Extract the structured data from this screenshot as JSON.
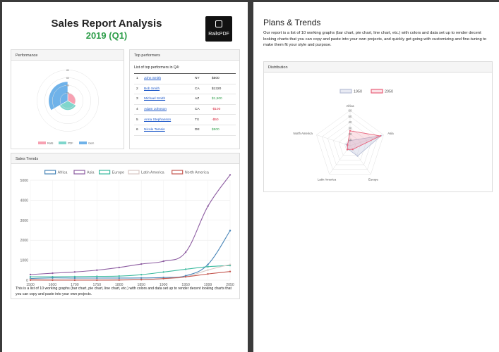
{
  "report": {
    "title": "Sales Report Analysis",
    "subtitle": "2019 (Q1)",
    "logo_text": "RailsPDF"
  },
  "performance": {
    "card_title": "Performance",
    "chart_data": {
      "type": "polar-area",
      "categories": [
        "Rails",
        "PDF",
        "Gem"
      ],
      "values": [
        20,
        25,
        50
      ],
      "colors": [
        "#f7a1b2",
        "#7fd6cc",
        "#6fb2e9"
      ],
      "ticks": [
        20,
        40,
        60,
        80
      ],
      "rmax": 90,
      "legend_position": "bottom"
    }
  },
  "top_performers": {
    "card_title": "Top performers",
    "caption": "List of top performers in Q4:",
    "rows": [
      {
        "num": "1",
        "name": "John Smith",
        "state": "NY",
        "amount": "$500",
        "tone": "neu"
      },
      {
        "num": "2",
        "name": "Bob Smith",
        "state": "CA",
        "amount": "$1320",
        "tone": "neu"
      },
      {
        "num": "3",
        "name": "Michael Smith",
        "state": "AZ",
        "amount": "$1,500",
        "tone": "pos"
      },
      {
        "num": "4",
        "name": "Adam Johnson",
        "state": "CA",
        "amount": "-$100",
        "tone": "neg"
      },
      {
        "num": "5",
        "name": "Anna Stephanson",
        "state": "TX",
        "amount": "-$50",
        "tone": "neg"
      },
      {
        "num": "6",
        "name": "Nicole Tamsin",
        "state": "DE",
        "amount": "$500",
        "tone": "pos"
      }
    ]
  },
  "sales_trends": {
    "card_title": "Sales Trends",
    "description": "This is a list of 10 working graphs (bar chart, pie chart, line chart, etc.) with colors and data set up to render decent looking charts that you can copy and paste into your own projects.",
    "chart_data": {
      "type": "line",
      "x": [
        1500,
        1600,
        1700,
        1750,
        1800,
        1850,
        1900,
        1950,
        1999,
        2050
      ],
      "series": [
        {
          "name": "Africa",
          "color": "#4a86b8",
          "values": [
            86,
            114,
            106,
            106,
            107,
            111,
            133,
            221,
            783,
            2478
          ]
        },
        {
          "name": "Asia",
          "color": "#8e5ea2",
          "values": [
            282,
            350,
            411,
            502,
            635,
            809,
            947,
            1402,
            3700,
            5267
          ]
        },
        {
          "name": "Europe",
          "color": "#3cba9f",
          "values": [
            168,
            170,
            178,
            190,
            203,
            276,
            408,
            547,
            675,
            734
          ]
        },
        {
          "name": "Latin America",
          "color": "#d8c9c5",
          "values": [
            40,
            20,
            10,
            16,
            24,
            38,
            74,
            167,
            508,
            784
          ]
        },
        {
          "name": "North America",
          "color": "#c45850",
          "values": [
            6,
            3,
            2,
            2,
            7,
            26,
            82,
            172,
            312,
            433
          ]
        }
      ],
      "ylim": [
        0,
        5000
      ],
      "yticks": [
        0,
        1000,
        2000,
        3000,
        4000,
        5000
      ],
      "grid": true,
      "legend_position": "top"
    }
  },
  "plans": {
    "title": "Plans & Trends",
    "text": "Our report is a list of 10 working graphs (bar chart, pie chart, line chart, etc.) with colors and data set up to render decent looking charts that you can copy and paste into your own projects, and quickly get going with customizing and fine-tuning to make them fit your style and purpose."
  },
  "distribution": {
    "card_title": "Distribution",
    "chart_data": {
      "type": "radar",
      "axes": [
        "Africa",
        "Asia",
        "Europe",
        "Latin America",
        "North America"
      ],
      "series": [
        {
          "name": "1950",
          "color": "#b8bfd6",
          "fill": "rgba(190,196,220,0.35)",
          "values": [
            8.77,
            55.61,
            21.69,
            6.62,
            6.82
          ]
        },
        {
          "name": "2050",
          "color": "#e8617a",
          "fill": "rgba(232,97,122,0.18)",
          "values": [
            25.48,
            54.16,
            7.61,
            8.06,
            4.45
          ]
        }
      ],
      "ticks": [
        10,
        20,
        30,
        40,
        50,
        60
      ],
      "rmax": 60,
      "legend_position": "top"
    }
  }
}
